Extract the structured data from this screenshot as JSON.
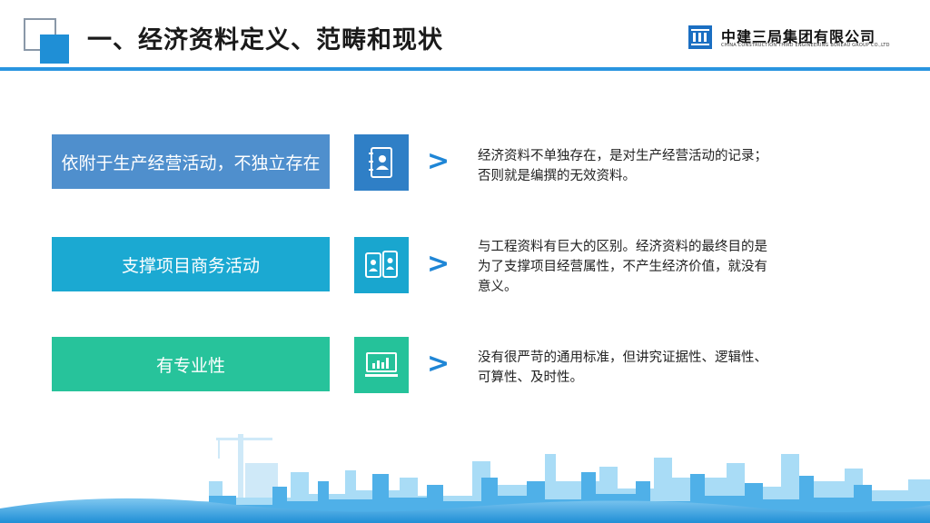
{
  "header": {
    "title": "一、经济资料定义、范畴和现状",
    "logo_cn": "中建三局集团有限公司",
    "logo_en": "CHINA CONSTRUCTION THIRD ENGINEERING BUREAU GROUP CO.,LTD"
  },
  "rows": [
    {
      "label": "依附于生产经营活动，不独立存在",
      "icon": "contact-book-icon",
      "color": "#4f8fcd",
      "icon_color": "#2f7fc6",
      "chevron": ">",
      "desc_lines": [
        "经济资料不单独存在，是对生产经营活动的记录；",
        "否则就是编撰的无效资料。"
      ]
    },
    {
      "label": "支撑项目商务活动",
      "icon": "mobile-users-icon",
      "color": "#1ba9d2",
      "icon_color": "#19a6cf",
      "chevron": ">",
      "desc_lines": [
        "与工程资料有巨大的区别。经济资料的最终目的是",
        "为了支撑项目经营属性，不产生经济价值，就没有",
        "意义。"
      ]
    },
    {
      "label": "有专业性",
      "icon": "monitor-chart-icon",
      "color": "#27c39b",
      "icon_color": "#25c29a",
      "chevron": ">",
      "desc_lines": [
        "没有很严苛的通用标准，但讲究证据性、逻辑性、",
        "可算性、及时性。"
      ]
    }
  ]
}
